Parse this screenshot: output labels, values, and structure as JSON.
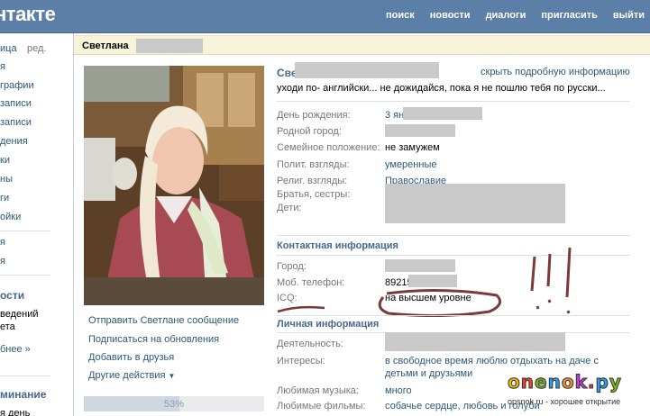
{
  "header": {
    "logo": "нтакте",
    "nav": [
      "поиск",
      "новости",
      "диалоги",
      "пригласить",
      "выйти"
    ]
  },
  "sidebar": {
    "edit_label": "ред.",
    "items": [
      "ица",
      "я",
      "графии",
      "записи",
      "записи",
      "дения",
      "ки",
      "ны",
      "ги",
      "ойки",
      "я",
      "я"
    ],
    "news_heading": "ости",
    "news_text": [
      "ведений",
      "ета"
    ],
    "news_more": "бнее »",
    "reminder_heading": "минание",
    "reminder_text": "я день"
  },
  "profile": {
    "title_name": "Светлана",
    "name": "Све",
    "more_info_link": "скрыть подробную информацию",
    "status": "уходи по- английски... не дожидайся, пока я не пошлю тебя по русски...",
    "info": {
      "birthday_label": "День рождения:",
      "birthday_value": "3 ян",
      "hometown_label": "Родной город:",
      "marital_label": "Семейное положение:",
      "marital_value": "не замужем",
      "political_label": "Полит. взгляды:",
      "political_value": "умеренные",
      "religion_label": "Религ. взгляды:",
      "religion_value": "Православие",
      "siblings_label": "Братья, сестры:",
      "children_label": "Дети:"
    },
    "contact": {
      "heading": "Контактная информация",
      "city_label": "Город:",
      "phone_label": "Моб. телефон:",
      "phone_value": "89215",
      "icq_label": "ICQ:",
      "icq_value": "на высшем уровне"
    },
    "personal": {
      "heading": "Личная информация",
      "activity_label": "Деятельность:",
      "interests_label": "Интересы:",
      "interests_line1": "в свободное время люблю отдыхать на даче с",
      "interests_line2": "детьми и друзьями",
      "music_label": "Любимая музыка:",
      "music_value": "много",
      "movies_label": "Любимые фильмы:",
      "movies_value": "собачье сердце, любовь и голуби"
    }
  },
  "actions": {
    "message": "Отправить Светлане сообщение",
    "subscribe": "Подписаться на обновления",
    "add_friend": "Добавить в друзья",
    "other": "Другие действия"
  },
  "rating": {
    "percent_label": "53%",
    "fraction": 0.53
  },
  "watermark": {
    "logo": "onenok.py",
    "tagline": "opsnok.ru - хорошее открытие"
  },
  "colors": {
    "header_bg": "#5b7fa6",
    "link": "#2b587a",
    "heading": "#45688e",
    "label": "#777777",
    "title_bg": "#f7f3d8",
    "annotation": "#7a3a3a"
  }
}
